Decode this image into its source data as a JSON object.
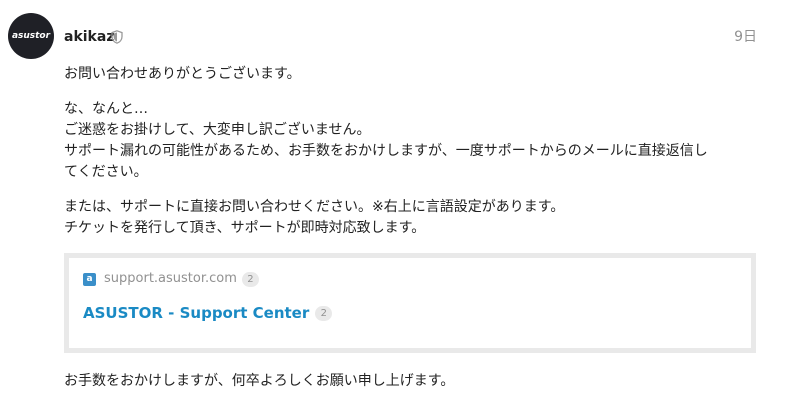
{
  "post": {
    "avatar_text": "asustor",
    "username": "akikaz",
    "user_badge_icon": "shield-icon",
    "date": "9日",
    "paragraphs": [
      {
        "lines": [
          "お問い合わせありがとうございます。"
        ]
      },
      {
        "lines": [
          "な、なんと…",
          "ご迷惑をお掛けして、大変申し訳ございません。",
          "サポート漏れの可能性があるため、お手数をおかけしますが、一度サポートからのメールに直接返信し",
          "てください。"
        ]
      },
      {
        "lines": [
          "または、サポートに直接お問い合わせください。※右上に言語設定があります。",
          "チケットを発行して頂き、サポートが即時対応致します。"
        ]
      }
    ],
    "onebox": {
      "favicon_icon": "asustor-favicon-icon",
      "source_domain": "support.asustor.com",
      "source_clicks": "2",
      "title": "ASUSTOR - Support Center",
      "title_clicks": "2"
    },
    "closing": "お手数をおかけしますが、何卒よろしくお願い申し上げます。",
    "colors": {
      "link": "#1a8ac4",
      "muted": "#919191",
      "text": "#222222",
      "border": "#e9e9e9"
    }
  }
}
